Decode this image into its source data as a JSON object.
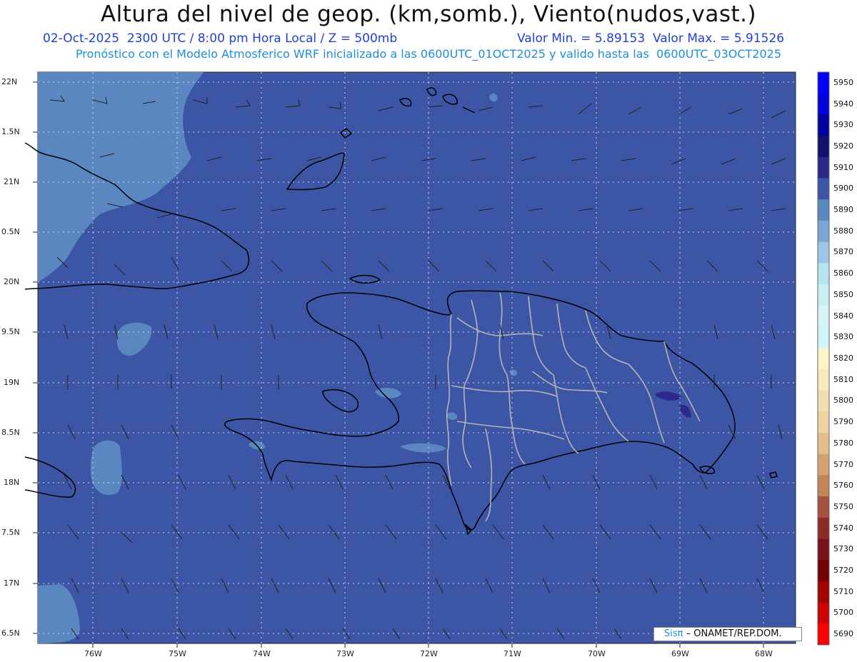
{
  "header": {
    "title": "Altura del nivel de geop. (km,somb.), Viento(nudos,vast.)",
    "date_line": "02-Oct-2025  2300 UTC / 8:00 pm Hora Local / Z = 500mb",
    "min_line": "Valor Min. = 5.89153  Valor Max. = 5.91526",
    "model_line": "Pronóstico con el Modelo Atmosferico WRF inicializado a las 0600UTC_01OCT2025 y valido hasta las  0600UTC_03OCT2025"
  },
  "map": {
    "lat_labels": [
      "22N",
      "1.5N",
      "21N",
      "0.5N",
      "20N",
      "9.5N",
      "19N",
      "8.5N",
      "18N",
      "7.5N",
      "17N",
      "6.5N"
    ],
    "lon_labels": [
      "76W",
      "75W",
      "74W",
      "73W",
      "72W",
      "71W",
      "70W",
      "69W",
      "68W"
    ],
    "colors": {
      "background_5900": "#3d55a5",
      "field_5890": "#5b87c1",
      "field_5910": "#2b2a8c",
      "coastline": "#000000",
      "provinces": "#b4b4b4",
      "grid": "#d0d4e6"
    }
  },
  "colorbar": {
    "levels": [
      "5950",
      "5940",
      "5930",
      "5920",
      "5910",
      "5900",
      "5890",
      "5880",
      "5870",
      "5860",
      "5850",
      "5840",
      "5830",
      "5820",
      "5810",
      "5800",
      "5790",
      "5780",
      "5770",
      "5760",
      "5750",
      "5740",
      "5730",
      "5720",
      "5710",
      "5700",
      "5690"
    ],
    "colors": [
      "#0000ff",
      "#0000dd",
      "#0000a0",
      "#12126e",
      "#2a2a8a",
      "#3d55a5",
      "#5b87c1",
      "#7aa6d4",
      "#9cc6e4",
      "#b8e2ef",
      "#c8eef4",
      "#d8f2f7",
      "#cff5fa",
      "#fdf3cb",
      "#f7e9bd",
      "#f2ddb0",
      "#eed3a2",
      "#e2bf8a",
      "#d4a270",
      "#c4845a",
      "#a5533e",
      "#8e2b28",
      "#791118",
      "#750000",
      "#a30000",
      "#cc0000",
      "#ff0000"
    ]
  },
  "credit": {
    "logo": "Sisπ",
    "text": "– ONAMET/REP.DOM."
  }
}
